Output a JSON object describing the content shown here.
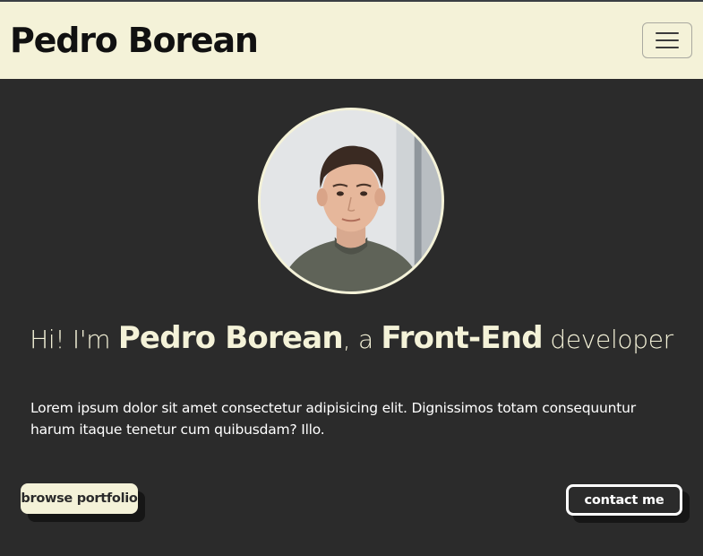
{
  "navbar": {
    "brand": "Pedro Borean",
    "toggle_icon": "hamburger-menu-icon"
  },
  "hero": {
    "avatar_alt": "profile-photo",
    "headline": {
      "part1": "Hi! I'm ",
      "name": "Pedro Borean",
      "part2": ", a ",
      "role": "Front-End",
      "part3": " developer"
    },
    "intro": "Lorem ipsum dolor sit amet consectetur adipisicing elit. Dignissimos totam consequuntur harum itaque tenetur cum quibusdam? Illo."
  },
  "actions": {
    "browse_label": "browse portfolio",
    "contact_label": "contact me"
  },
  "colors": {
    "background": "#2b2b2b",
    "accent_cream": "#f4f2d8",
    "text_white": "#ffffff",
    "text_dark": "#111111"
  }
}
